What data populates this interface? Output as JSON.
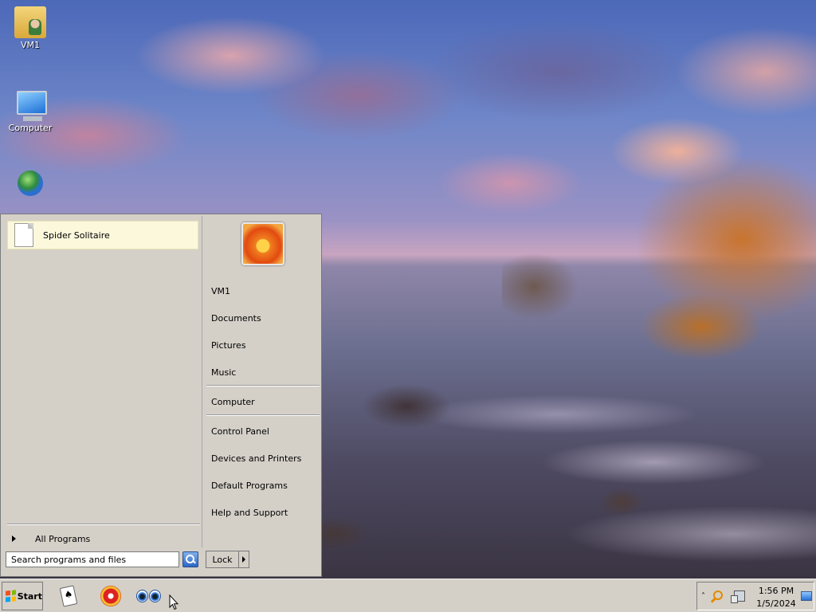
{
  "desktop": {
    "icons": [
      {
        "label": "VM1",
        "icon": "user-folder-icon"
      },
      {
        "label": "Computer",
        "icon": "computer-icon"
      },
      {
        "label": "",
        "icon": "network-globe-icon"
      }
    ]
  },
  "start_menu": {
    "pinned": [
      {
        "label": "Spider Solitaire",
        "icon": "document-icon"
      }
    ],
    "all_programs": "All Programs",
    "search": {
      "placeholder": "Search programs and files",
      "value": ""
    },
    "right_pane": {
      "user_picture": "flower-user-picture",
      "items_group1": [
        "VM1",
        "Documents",
        "Pictures",
        "Music"
      ],
      "items_group2": [
        "Computer"
      ],
      "items_group3": [
        "Control Panel",
        "Devices and Printers",
        "Default Programs",
        "Help and Support"
      ]
    },
    "lock_label": "Lock"
  },
  "taskbar": {
    "start_label": "Start",
    "apps": [
      {
        "name": "spider-solitaire",
        "icon": "cards-icon"
      },
      {
        "name": "media-app",
        "icon": "disc-icon"
      },
      {
        "name": "eyes-app",
        "icon": "eyes-icon"
      }
    ],
    "tray": {
      "time": "1:56 PM",
      "date": "1/5/2024"
    }
  },
  "colors": {
    "menu_bg": "#d4d0c8",
    "pinned_highlight": "#fbf8dc",
    "taskbar_bg": "#d4d0c8"
  }
}
